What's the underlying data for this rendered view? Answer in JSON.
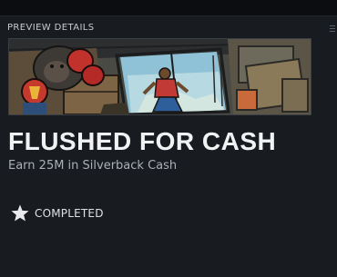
{
  "panel": {
    "section_header": "PREVIEW DETAILS"
  },
  "mission": {
    "title": "FLUSHED FOR CASH",
    "description": "Earn 25M in Silverback Cash",
    "status_label": "COMPLETED",
    "status_icon": "star-icon"
  },
  "colors": {
    "background": "#181b20",
    "topbar": "#0b0d10",
    "title": "#f1f2f3",
    "description": "#aab0b6"
  }
}
